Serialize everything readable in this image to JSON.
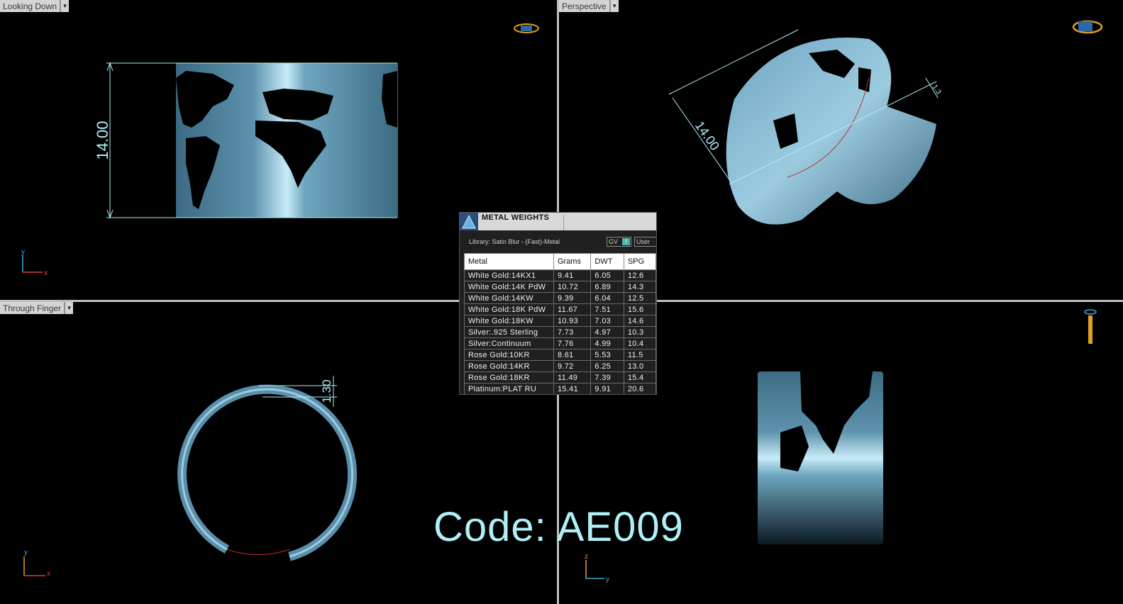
{
  "viewports": {
    "top_left": {
      "label": "Looking Down",
      "dimension": "14.00",
      "axis": {
        "vertical": "y",
        "horizontal": "x"
      }
    },
    "top_right": {
      "label": "Perspective",
      "dimension_main": "14.00",
      "dimension_small": "1.3"
    },
    "bottom_left": {
      "label": "Through Finger",
      "dimension": "1.30",
      "axis": {
        "vertical": "y",
        "horizontal": "x"
      }
    },
    "bottom_right": {
      "axis": {
        "vertical": "z",
        "horizontal": "y"
      }
    }
  },
  "metal_weights": {
    "title": "METAL WEIGHTS",
    "library": "Library: Satin Blur - (Fast)-Metal",
    "gv_label": "GV",
    "gv_toggle": "I",
    "user_label": "User",
    "columns": [
      "Metal",
      "Grams",
      "DWT",
      "SPG"
    ],
    "rows": [
      [
        "White Gold:14KX1",
        "9.41",
        "6.05",
        "12.6"
      ],
      [
        "White Gold:14K PdW",
        "10.72",
        "6.89",
        "14.3"
      ],
      [
        "White Gold:14KW",
        "9.39",
        "6.04",
        "12.5"
      ],
      [
        "White Gold:18K PdW",
        "11.67",
        "7.51",
        "15.6"
      ],
      [
        "White Gold:18KW",
        "10.93",
        "7.03",
        "14.6"
      ],
      [
        "Silver:.925 Sterling",
        "7.73",
        "4.97",
        "10.3"
      ],
      [
        "Silver:Continuum",
        "7.76",
        "4.99",
        "10.4"
      ],
      [
        "Rose Gold:10KR",
        "8.61",
        "5.53",
        "11.5"
      ],
      [
        "Rose Gold:14KR",
        "9.72",
        "6.25",
        "13.0"
      ],
      [
        "Rose Gold:18KR",
        "11.49",
        "7.39",
        "15.4"
      ],
      [
        "Platinum:PLAT RU",
        "15.41",
        "9.91",
        "20.6"
      ]
    ]
  },
  "code_label": "Code: AE009",
  "colors": {
    "metal": "#6fa6c0",
    "dimension": "#aef0f6",
    "background": "#000000",
    "separator": "#bfbfbf"
  }
}
